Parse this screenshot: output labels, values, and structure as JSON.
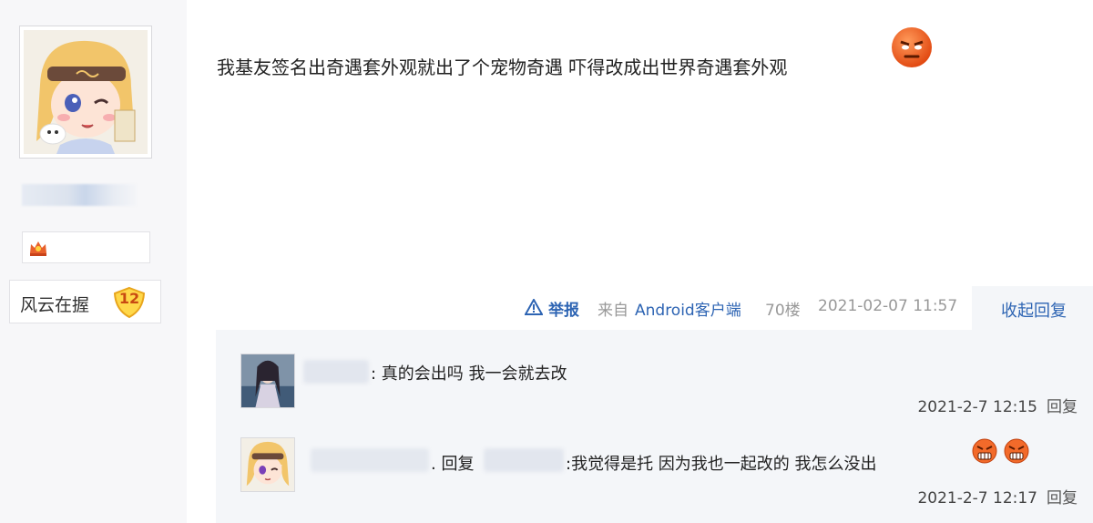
{
  "author": {
    "level_title": "风云在握",
    "level": "12"
  },
  "post": {
    "text": "我基友签名出奇遇套外观就出了个宠物奇遇 吓得改成出世界奇遇套外观",
    "emoji_icon": "angry-face-emoji"
  },
  "meta": {
    "report_label": "举报",
    "from_prefix": "来自",
    "from_app": "Android客户端",
    "floor": "70楼",
    "time": "2021-02-07 11:57",
    "collapse_label": "收起回复"
  },
  "replies": [
    {
      "text": ": 真的会出吗 我一会就去改",
      "time": "2021-2-7 12:15",
      "reply_label": "回复"
    },
    {
      "prefix": ". 回复",
      "text": ":我觉得是托 因为我也一起改的 我怎么没出",
      "time": "2021-2-7 12:17",
      "reply_label": "回复"
    }
  ],
  "colors": {
    "link": "#2d64b3",
    "reply_bg": "#f4f6f9",
    "sidebar_bg": "#f7f7f9"
  }
}
